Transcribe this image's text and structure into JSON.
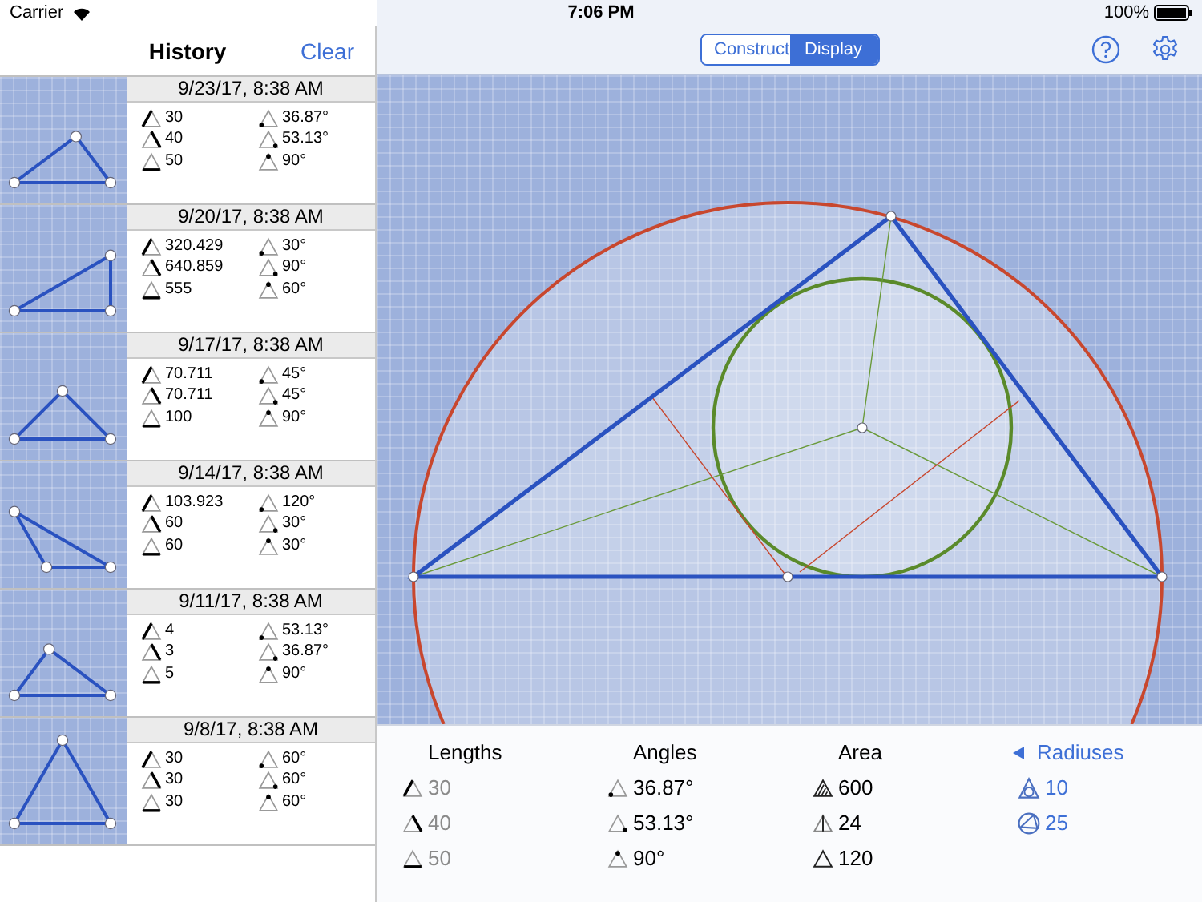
{
  "status_bar": {
    "carrier": "Carrier",
    "time": "7:06 PM",
    "battery": "100%"
  },
  "history": {
    "title": "History",
    "clear": "Clear",
    "items": [
      {
        "date": "9/23/17, 8:38 AM",
        "sides": [
          "30",
          "40",
          "50"
        ],
        "angles": [
          "36.87°",
          "53.13°",
          "90°"
        ]
      },
      {
        "date": "9/20/17, 8:38 AM",
        "sides": [
          "320.429",
          "640.859",
          "555"
        ],
        "angles": [
          "30°",
          "90°",
          "60°"
        ]
      },
      {
        "date": "9/17/17, 8:38 AM",
        "sides": [
          "70.711",
          "70.711",
          "100"
        ],
        "angles": [
          "45°",
          "45°",
          "90°"
        ]
      },
      {
        "date": "9/14/17, 8:38 AM",
        "sides": [
          "103.923",
          "60",
          "60"
        ],
        "angles": [
          "120°",
          "30°",
          "30°"
        ]
      },
      {
        "date": "9/11/17, 8:38 AM",
        "sides": [
          "4",
          "3",
          "5"
        ],
        "angles": [
          "53.13°",
          "36.87°",
          "90°"
        ]
      },
      {
        "date": "9/8/17, 8:38 AM",
        "sides": [
          "30",
          "30",
          "30"
        ],
        "angles": [
          "60°",
          "60°",
          "60°"
        ]
      }
    ]
  },
  "toolbar": {
    "segments": [
      {
        "label": "Construct",
        "selected": false
      },
      {
        "label": "Display",
        "selected": true
      }
    ]
  },
  "stats": {
    "lengths": {
      "title": "Lengths",
      "values": [
        "30",
        "40",
        "50"
      ]
    },
    "angles": {
      "title": "Angles",
      "values": [
        "36.87°",
        "53.13°",
        "90°"
      ]
    },
    "area": {
      "title": "Area",
      "items": [
        {
          "kind": "hatched",
          "value": "600"
        },
        {
          "kind": "altitude",
          "value": "24"
        },
        {
          "kind": "outline",
          "value": "120"
        }
      ]
    },
    "radiuses": {
      "title": "Radiuses",
      "items": [
        {
          "kind": "inscribed",
          "value": "10"
        },
        {
          "kind": "circumscribed",
          "value": "25"
        }
      ]
    }
  }
}
